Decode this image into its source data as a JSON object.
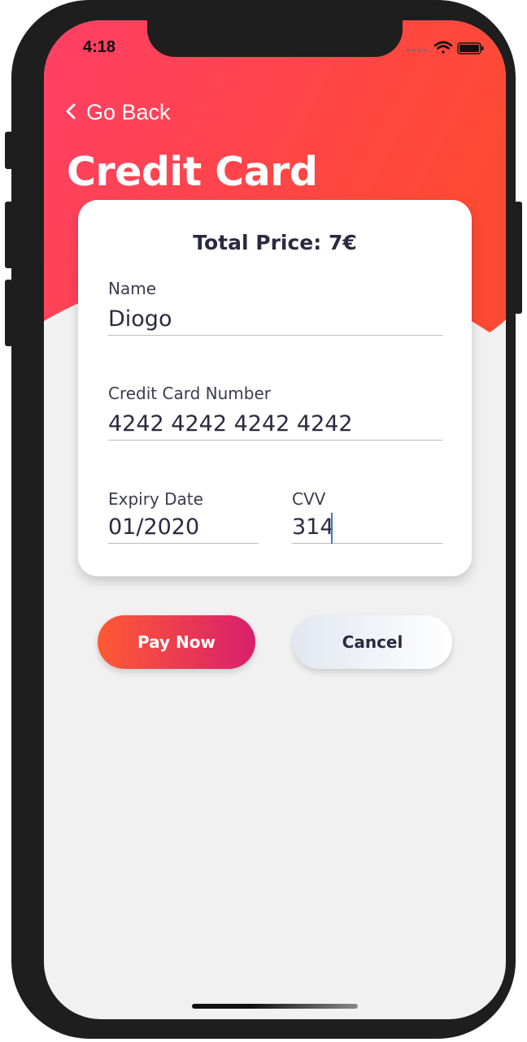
{
  "status_bar": {
    "time": "4:18",
    "signal_icon": "cellular-dots-icon",
    "wifi_icon": "wifi-icon",
    "battery_icon": "battery-icon"
  },
  "nav": {
    "back_label": "Go Back",
    "back_icon": "chevron-left-icon"
  },
  "header": {
    "title": "Credit Card",
    "gradient_start": "#ff3f66",
    "gradient_end": "#ff4a33"
  },
  "card": {
    "total_price": "Total Price: 7€",
    "fields": {
      "name": {
        "label": "Name",
        "value": "Diogo"
      },
      "card_number": {
        "label": "Credit Card Number",
        "value": "4242 4242 4242 4242"
      },
      "expiry": {
        "label": "Expiry Date",
        "value": "01/2020"
      },
      "cvv": {
        "label": "CVV",
        "value": "314"
      }
    }
  },
  "actions": {
    "pay_label": "Pay Now",
    "cancel_label": "Cancel",
    "pay_gradient_start": "#ff5a34",
    "pay_gradient_end": "#d81f6c"
  }
}
